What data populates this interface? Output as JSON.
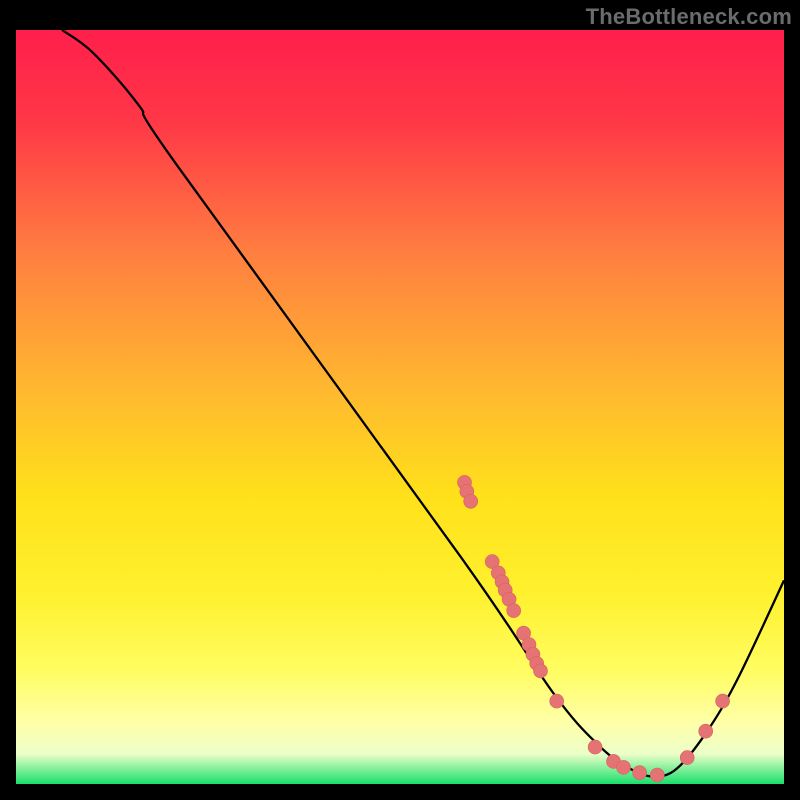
{
  "attribution": "TheBottleneck.com",
  "colors": {
    "gradient_top": "#ff1f4b",
    "gradient_bottom": "#18e06c",
    "curve": "#000000",
    "dot_fill": "#e57373",
    "dot_stroke": "#d66262"
  },
  "chart_data": {
    "type": "line",
    "title": "",
    "xlabel": "",
    "ylabel": "",
    "xlim": [
      0,
      100
    ],
    "ylim": [
      0,
      100
    ],
    "curve_points": [
      {
        "x": 6,
        "y": 100
      },
      {
        "x": 10,
        "y": 97
      },
      {
        "x": 16,
        "y": 90
      },
      {
        "x": 21,
        "y": 82
      },
      {
        "x": 58,
        "y": 30
      },
      {
        "x": 70,
        "y": 12
      },
      {
        "x": 76,
        "y": 5
      },
      {
        "x": 80,
        "y": 2
      },
      {
        "x": 83,
        "y": 1
      },
      {
        "x": 86,
        "y": 2
      },
      {
        "x": 90,
        "y": 7
      },
      {
        "x": 94,
        "y": 14
      },
      {
        "x": 100,
        "y": 27
      }
    ],
    "highlight_points": [
      {
        "x": 58.4,
        "y": 40.0
      },
      {
        "x": 58.7,
        "y": 38.8
      },
      {
        "x": 59.2,
        "y": 37.5
      },
      {
        "x": 62.0,
        "y": 29.5
      },
      {
        "x": 62.8,
        "y": 28.0
      },
      {
        "x": 63.3,
        "y": 26.8
      },
      {
        "x": 63.7,
        "y": 25.7
      },
      {
        "x": 64.2,
        "y": 24.5
      },
      {
        "x": 64.8,
        "y": 23.0
      },
      {
        "x": 66.1,
        "y": 20.0
      },
      {
        "x": 66.8,
        "y": 18.5
      },
      {
        "x": 67.3,
        "y": 17.2
      },
      {
        "x": 67.8,
        "y": 16.0
      },
      {
        "x": 68.3,
        "y": 15.0
      },
      {
        "x": 70.4,
        "y": 11.0
      },
      {
        "x": 75.4,
        "y": 4.9
      },
      {
        "x": 77.8,
        "y": 3.0
      },
      {
        "x": 79.1,
        "y": 2.2
      },
      {
        "x": 81.2,
        "y": 1.5
      },
      {
        "x": 83.5,
        "y": 1.2
      },
      {
        "x": 87.4,
        "y": 3.5
      },
      {
        "x": 89.8,
        "y": 7.0
      },
      {
        "x": 92.0,
        "y": 11.0
      }
    ]
  }
}
